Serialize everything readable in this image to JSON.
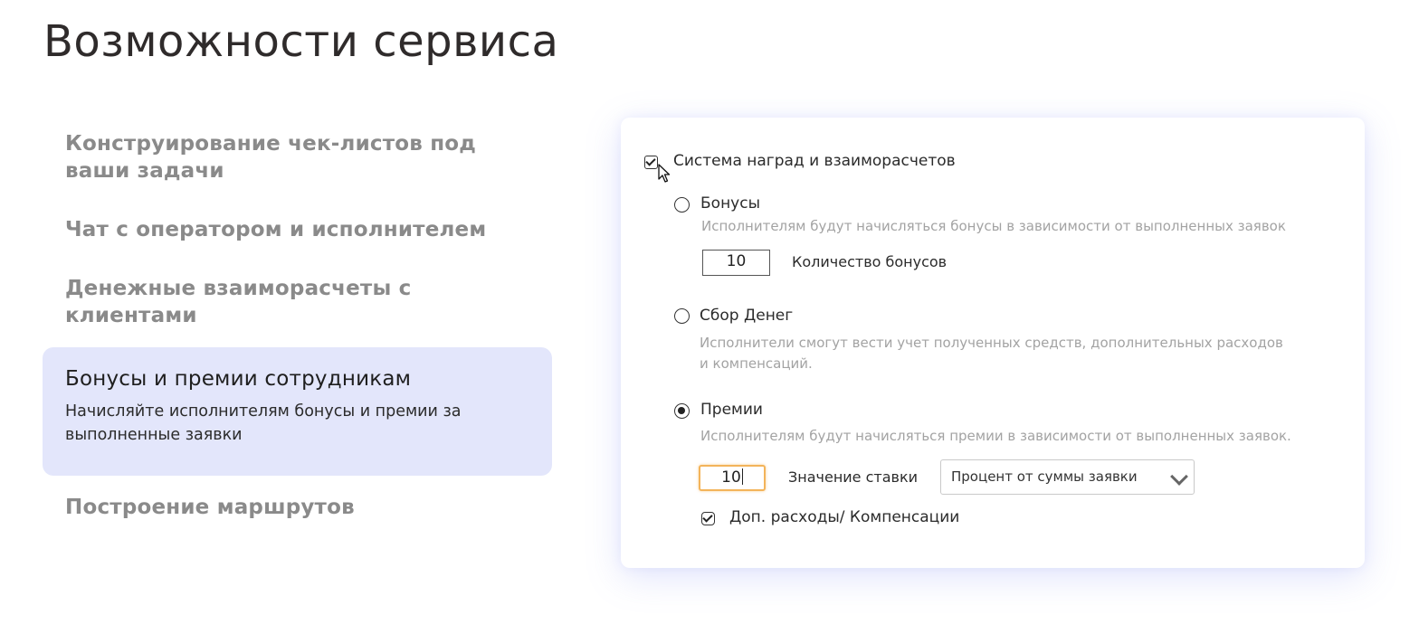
{
  "page_title": "Возможности сервиса",
  "features": [
    {
      "title": "Конструирование чек-листов под ваши задачи",
      "active": false
    },
    {
      "title": "Чат с оператором и исполнителем",
      "active": false
    },
    {
      "title": "Денежные взаиморасчеты с клиентами",
      "active": false
    },
    {
      "title": "Бонусы и премии сотрудникам",
      "description": "Начисляйте исполнителям бонусы и премии за выполненные заявки",
      "active": true
    },
    {
      "title": "Построение маршрутов",
      "active": false
    }
  ],
  "panel": {
    "master_checkbox": {
      "label": "Система наград и взаиморасчетов",
      "checked": true
    },
    "options": [
      {
        "label": "Бонусы",
        "selected": false,
        "hint": "Исполнителям будут начисляться бонусы в зависимости от выполненных заявок",
        "input_value": "10",
        "input_label": "Количество бонусов"
      },
      {
        "label": "Сбор Денег",
        "selected": false,
        "hint_line1": "Исполнители смогут вести учет полученных средств, дополнительных расходов",
        "hint_line2": "и компенсаций."
      },
      {
        "label": "Премии",
        "selected": true,
        "hint": "Исполнителям будут начисляться премии в зависимости от выполненных заявок.",
        "input_value": "10",
        "input_label": "Значение ставки",
        "select_value": "Процент от суммы заявки",
        "extra_checkbox": {
          "label": "Доп. расходы/ Компенсации",
          "checked": true
        }
      }
    ]
  },
  "colors": {
    "active_bg": "#e3e6fb",
    "focus_border": "#f3b45a",
    "muted_text": "#8a8a8a",
    "hint_text": "#a3a3a3"
  }
}
